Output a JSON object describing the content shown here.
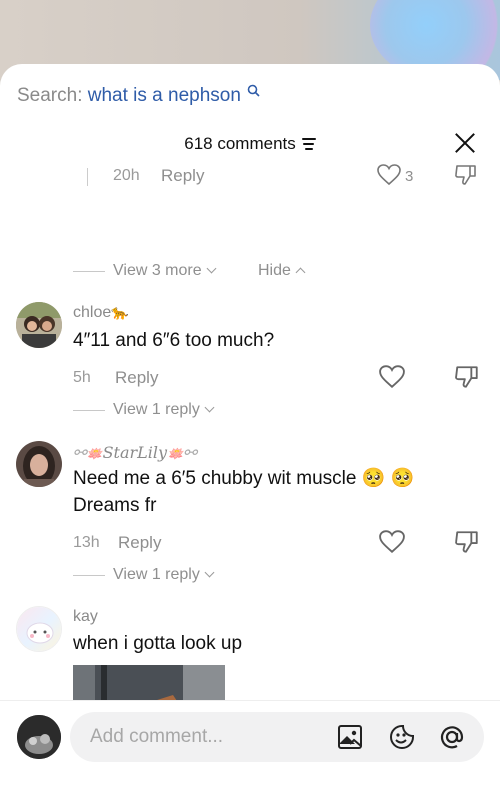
{
  "search": {
    "prefix": "Search: ",
    "query": "what is a nephson"
  },
  "header": {
    "count_label": "618 comments"
  },
  "prev_thread": {
    "time": "20h",
    "reply_label": "Reply",
    "like_count": "3",
    "view_more": "View 3 more",
    "hide": "Hide"
  },
  "comments": [
    {
      "username": "chloe",
      "username_emoji": "🐆",
      "text": "4″11 and 6″6 too much?",
      "time": "5h",
      "reply_label": "Reply",
      "view_replies": "View 1 reply"
    },
    {
      "username": "StarLily",
      "text": "Need me a 6′5 chubby wit muscle",
      "text_line2": "Dreams fr",
      "time": "13h",
      "reply_label": "Reply",
      "view_replies": "View 1 reply"
    },
    {
      "username": "kay",
      "text": "when i gotta look up"
    }
  ],
  "composer": {
    "placeholder": "Add comment..."
  },
  "colors": {
    "link_blue": "#2f5ca8",
    "muted": "#8f8f8f"
  }
}
